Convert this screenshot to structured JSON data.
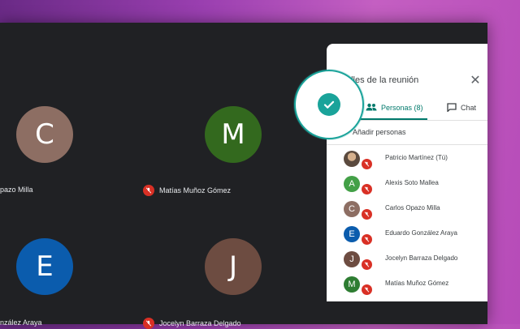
{
  "meeting": {
    "tiles": [
      {
        "initial": "C",
        "color": "#8d6e63"
      },
      {
        "initial": "M",
        "color": "#33691e"
      },
      {
        "initial": "E",
        "color": "#0b5cad"
      },
      {
        "initial": "J",
        "color": "#6d4c41"
      }
    ],
    "tile_names": [
      "pazo Milla",
      "Matías Muñoz Gómez",
      "nzález Araya",
      "Jocelyn Barraza Delgado"
    ]
  },
  "panel": {
    "title": "alles de la reunión",
    "tabs": {
      "people": "Personas (8)",
      "chat": "Chat"
    },
    "add_people": "Añadir personas",
    "participants": [
      {
        "name": "Patricio Martínez (Tú)",
        "initial": "",
        "color": "#5b4a3e"
      },
      {
        "name": "Alexis Soto Mallea",
        "initial": "A",
        "color": "#43a047"
      },
      {
        "name": "Carlos Opazo Milla",
        "initial": "C",
        "color": "#8d6e63"
      },
      {
        "name": "Eduardo González Araya",
        "initial": "E",
        "color": "#0b5cad"
      },
      {
        "name": "Jocelyn Barraza Delgado",
        "initial": "J",
        "color": "#6d4c41"
      },
      {
        "name": "Matías Muñoz Gómez",
        "initial": "M",
        "color": "#2e7d32"
      },
      {
        "name": "",
        "initial": "",
        "color": "#7b1fa2"
      }
    ]
  },
  "colors": {
    "accent": "#1aa39a",
    "mic_off": "#d93025",
    "tab_active": "#00796b"
  },
  "icons": {
    "star": "star-icon",
    "extension": "check-extension-icon",
    "menu": "kebab-menu-icon",
    "close": "close-icon",
    "people": "people-icon",
    "chat": "chat-icon"
  }
}
